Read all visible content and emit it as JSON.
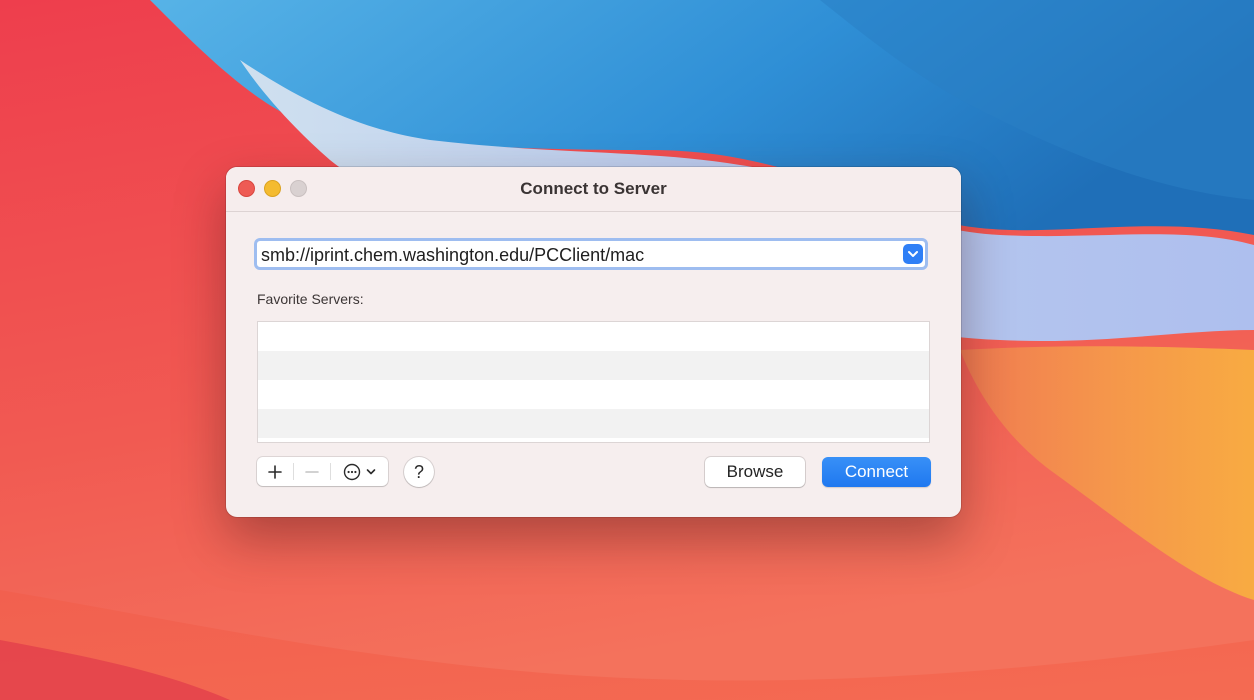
{
  "window": {
    "title": "Connect to Server"
  },
  "address": {
    "value": "smb://iprint.chem.washington.edu/PCClient/mac",
    "dropdown_icon": "chevron-down-icon"
  },
  "favorites": {
    "label": "Favorite Servers:",
    "items": []
  },
  "toolbar": {
    "add_icon": "plus-icon",
    "remove_icon": "minus-icon",
    "actions_icon": "ellipsis-circle-icon",
    "help_label": "?",
    "browse_label": "Browse",
    "connect_label": "Connect"
  },
  "colors": {
    "accent": "#1f78f0",
    "close": "#ee5b54",
    "minimize": "#f4bb30",
    "zoom_disabled": "#d9d1d1"
  }
}
